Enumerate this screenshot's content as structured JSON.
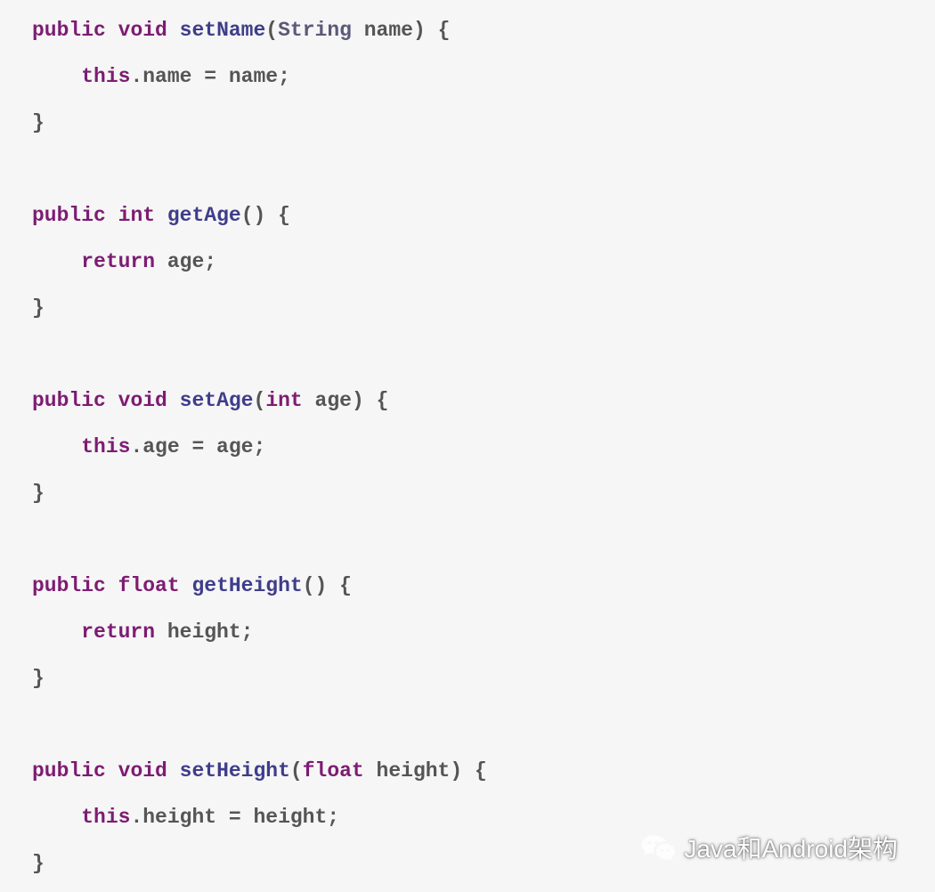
{
  "code": {
    "lines": [
      {
        "segments": [
          {
            "t": "public",
            "c": "kw"
          },
          {
            "t": " "
          },
          {
            "t": "void",
            "c": "kw"
          },
          {
            "t": " "
          },
          {
            "t": "setName",
            "c": "fn"
          },
          {
            "t": "("
          },
          {
            "t": "String",
            "c": "type"
          },
          {
            "t": " name"
          },
          {
            "t": ")"
          },
          {
            "t": " {"
          }
        ]
      },
      {
        "segments": [
          {
            "t": "    "
          },
          {
            "t": "this",
            "c": "kw"
          },
          {
            "t": ".name = name;"
          }
        ]
      },
      {
        "segments": [
          {
            "t": "}"
          }
        ]
      },
      {
        "segments": [
          {
            "t": ""
          }
        ]
      },
      {
        "segments": [
          {
            "t": "public",
            "c": "kw"
          },
          {
            "t": " "
          },
          {
            "t": "int",
            "c": "kw"
          },
          {
            "t": " "
          },
          {
            "t": "getAge",
            "c": "fn"
          },
          {
            "t": "()"
          },
          {
            "t": " {"
          }
        ]
      },
      {
        "segments": [
          {
            "t": "    "
          },
          {
            "t": "return",
            "c": "kw"
          },
          {
            "t": " age;"
          }
        ]
      },
      {
        "segments": [
          {
            "t": "}"
          }
        ]
      },
      {
        "segments": [
          {
            "t": ""
          }
        ]
      },
      {
        "segments": [
          {
            "t": "public",
            "c": "kw"
          },
          {
            "t": " "
          },
          {
            "t": "void",
            "c": "kw"
          },
          {
            "t": " "
          },
          {
            "t": "setAge",
            "c": "fn"
          },
          {
            "t": "("
          },
          {
            "t": "int",
            "c": "kw"
          },
          {
            "t": " age"
          },
          {
            "t": ")"
          },
          {
            "t": " {"
          }
        ]
      },
      {
        "segments": [
          {
            "t": "    "
          },
          {
            "t": "this",
            "c": "kw"
          },
          {
            "t": ".age = age;"
          }
        ]
      },
      {
        "segments": [
          {
            "t": "}"
          }
        ]
      },
      {
        "segments": [
          {
            "t": ""
          }
        ]
      },
      {
        "segments": [
          {
            "t": "public",
            "c": "kw"
          },
          {
            "t": " "
          },
          {
            "t": "float",
            "c": "kw"
          },
          {
            "t": " "
          },
          {
            "t": "getHeight",
            "c": "fn"
          },
          {
            "t": "()"
          },
          {
            "t": " {"
          }
        ]
      },
      {
        "segments": [
          {
            "t": "    "
          },
          {
            "t": "return",
            "c": "kw"
          },
          {
            "t": " height;"
          }
        ]
      },
      {
        "segments": [
          {
            "t": "}"
          }
        ]
      },
      {
        "segments": [
          {
            "t": ""
          }
        ]
      },
      {
        "segments": [
          {
            "t": "public",
            "c": "kw"
          },
          {
            "t": " "
          },
          {
            "t": "void",
            "c": "kw"
          },
          {
            "t": " "
          },
          {
            "t": "setHeight",
            "c": "fn"
          },
          {
            "t": "("
          },
          {
            "t": "float",
            "c": "kw"
          },
          {
            "t": " height"
          },
          {
            "t": ")"
          },
          {
            "t": " {"
          }
        ]
      },
      {
        "segments": [
          {
            "t": "    "
          },
          {
            "t": "this",
            "c": "kw"
          },
          {
            "t": ".height = height;"
          }
        ]
      },
      {
        "segments": [
          {
            "t": "}"
          }
        ]
      }
    ]
  },
  "watermark": {
    "text": "Java和Android架构"
  }
}
